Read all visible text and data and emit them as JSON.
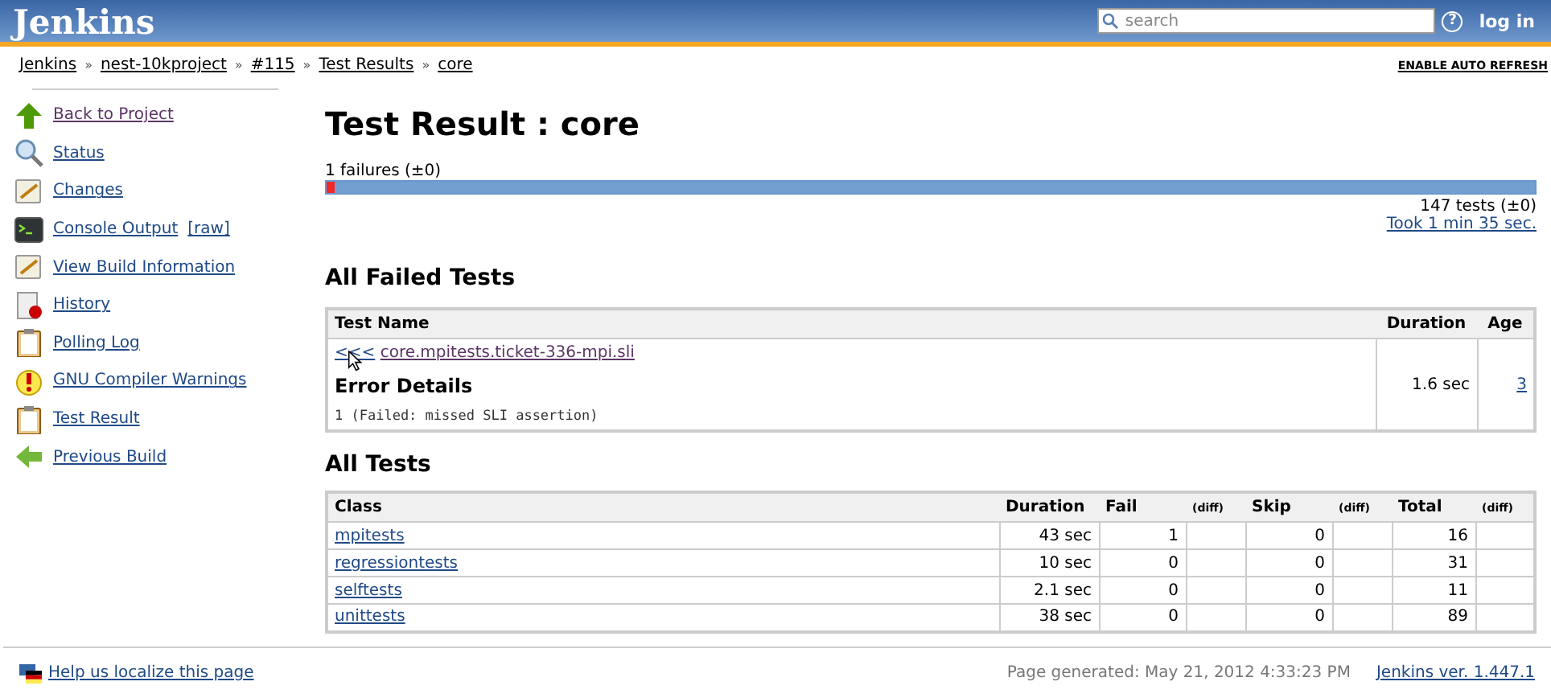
{
  "header": {
    "logo": "Jenkins",
    "search": {
      "placeholder": "search"
    },
    "help": "?",
    "login": "log in"
  },
  "breadcrumbs": [
    "Jenkins",
    "nest-10kproject",
    "#115",
    "Test Results",
    "core"
  ],
  "breadcrumb_separator": "»",
  "auto_refresh": "ENABLE AUTO REFRESH",
  "sidebar": {
    "items": [
      {
        "label": "Back to Project",
        "kind": "up",
        "visited": true
      },
      {
        "label": "Status",
        "kind": "magnifier",
        "visited": false
      },
      {
        "label": "Changes",
        "kind": "notepad",
        "visited": false
      },
      {
        "label": "Console Output",
        "extra": "[raw]",
        "kind": "terminal",
        "visited": false
      },
      {
        "label": "View Build Information",
        "kind": "notepad",
        "visited": false
      },
      {
        "label": "History",
        "kind": "chart",
        "visited": false
      },
      {
        "label": "Polling Log",
        "kind": "clipboard",
        "visited": false
      },
      {
        "label": "GNU Compiler Warnings",
        "kind": "warning",
        "visited": false
      },
      {
        "label": "Test Result",
        "kind": "clipboard",
        "visited": false
      },
      {
        "label": "Previous Build",
        "kind": "back",
        "visited": false
      }
    ]
  },
  "title": "Test Result : core",
  "summary": {
    "failures": "1 failures (±0)",
    "level": 0.0068,
    "tests": "147 tests (±0)",
    "took": "Took 1 min 35 sec."
  },
  "failed_section": {
    "heading": "All Failed Tests",
    "columns": [
      "Test Name",
      "Duration",
      "Age"
    ],
    "rows": [
      {
        "toggle": "<<<",
        "name": "core.mpitests.ticket-336-mpi.sli",
        "details_heading": "Error Details",
        "details": "1 (Failed: missed SLI assertion)",
        "duration": "1.6 sec",
        "age": "3"
      }
    ]
  },
  "all_section": {
    "heading": "All Tests",
    "columns": [
      "Class",
      "Duration",
      "Fail",
      "(diff)",
      "Skip",
      "(diff)",
      "Total",
      "(diff)"
    ],
    "rows": [
      {
        "class": "mpitests",
        "duration": "43 sec",
        "fail": "1",
        "skip": "0",
        "total": "16"
      },
      {
        "class": "regressiontests",
        "duration": "10 sec",
        "fail": "0",
        "skip": "0",
        "total": "31"
      },
      {
        "class": "selftests",
        "duration": "2.1 sec",
        "fail": "0",
        "skip": "0",
        "total": "11"
      },
      {
        "class": "unittests",
        "duration": "38 sec",
        "fail": "0",
        "skip": "0",
        "total": "89"
      }
    ]
  },
  "footer": {
    "localize": "Help us localize this page",
    "generated": "Page generated: May 21, 2012 4:33:23 PM",
    "version": "Jenkins ver. 1.447.1"
  }
}
